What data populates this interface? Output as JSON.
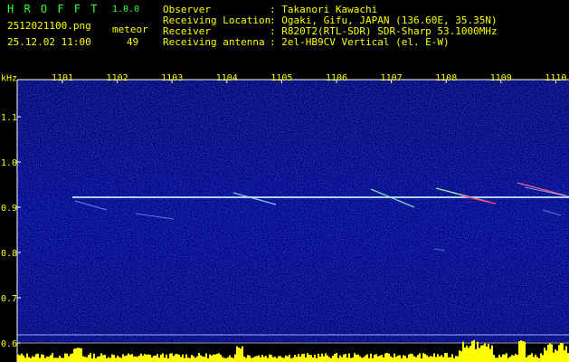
{
  "app": {
    "name": "H R O F F T",
    "version": "1.0.0"
  },
  "file": {
    "name": "2512021100.png",
    "datetime": "25.12.02 11:00"
  },
  "meteor": {
    "label": "meteor",
    "count": "49"
  },
  "info": [
    {
      "key": "Observer",
      "value": ": Takanori Kawachi"
    },
    {
      "key": "Receiving Location",
      "value": ": Ogaki, Gifu, JAPAN (136.60E, 35.35N)"
    },
    {
      "key": "Receiver",
      "value": ": R820T2(RTL-SDR) SDR-Sharp 53.1000MHz"
    },
    {
      "key": "Receiving antenna",
      "value": ": 2el-HB9CV Vertical (el. E-W)"
    }
  ],
  "colors": {
    "header_green": "#33ff33",
    "header_yellow": "#ffff00",
    "background": "#000080"
  },
  "spectrogram": {
    "y_unit": "kHz",
    "y_ticks": [
      "1.1",
      "1.0",
      "0.9",
      "0.8",
      "0.7",
      "0.6"
    ],
    "time_ticks": [
      "1101",
      "1102",
      "1103",
      "1104",
      "1105",
      "1106",
      "1107",
      "1108",
      "1109",
      "1110"
    ]
  }
}
